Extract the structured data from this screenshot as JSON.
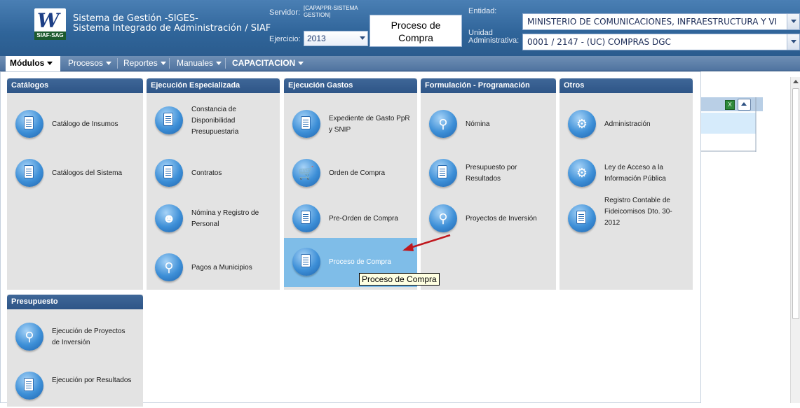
{
  "header": {
    "logo_word": "W",
    "logo_tag": "SIAF-SAG",
    "title_line1": "Sistema de Gestión -SIGES-",
    "title_line2": "Sistema Integrado de Administración / SIAF",
    "servidor_label": "Servidor:",
    "servidor_value_1": "[CAPAPPR-SISTEMA",
    "servidor_value_2": "GESTION]",
    "ejercicio_label": "Ejercicio:",
    "ejercicio_value": "2013",
    "page_title_1": "Proceso de",
    "page_title_2": "Compra",
    "entidad_label": "Entidad:",
    "entidad_value": "MINISTERIO DE  COMUNICACIONES, INFRAESTRUCTURA Y VI",
    "unidad_label_1": "Unidad",
    "unidad_label_2": "Administrativa:",
    "unidad_value": "0001 / 2147 - (UC) COMPRAS DGC"
  },
  "menubar": {
    "modulos": "Módulos",
    "procesos": "Procesos",
    "reportes": "Reportes",
    "manuales": "Manuales",
    "capacitacion": "CAPACITACION"
  },
  "sections": {
    "catalogos": {
      "title": "Catálogos",
      "items": [
        "Catálogo de Insumos",
        "Catálogos del Sistema"
      ]
    },
    "ejecucion_especializada": {
      "title": "Ejecución Especializada",
      "items": [
        "Constancia de Disponibilidad Presupuestaria",
        "Contratos",
        "Nómina y Registro de Personal",
        "Pagos a Municipios"
      ]
    },
    "ejecucion_gastos": {
      "title": "Ejecución Gastos",
      "items": [
        "Expediente de Gasto PpR y SNIP",
        "Orden de Compra",
        "Pre-Orden de Compra",
        "Proceso de Compra"
      ]
    },
    "formulacion": {
      "title": "Formulación - Programación",
      "items": [
        "Nómina",
        "Presupuesto por Resultados",
        "Proyectos de Inversión"
      ]
    },
    "otros": {
      "title": "Otros",
      "items": [
        "Administración",
        "Ley de Acceso a la Información Pública",
        "Registro Contable de Fideicomisos Dto. 30-2012"
      ]
    },
    "presupuesto": {
      "title": "Presupuesto",
      "items": [
        "Ejecución de Proyectos de Inversión",
        "Ejecución por Resultados"
      ]
    }
  },
  "tooltip": "Proceso de Compra",
  "colors": {
    "header": "#2f6499",
    "section_header": "#2e5587",
    "section_bg": "#e3e3e3",
    "hover_item": "#7fbde8",
    "arrow": "#c0181e"
  },
  "icons": [
    "document-icon",
    "cart-icon",
    "people-icon",
    "search-people-icon",
    "gears-icon",
    "excel-icon"
  ]
}
